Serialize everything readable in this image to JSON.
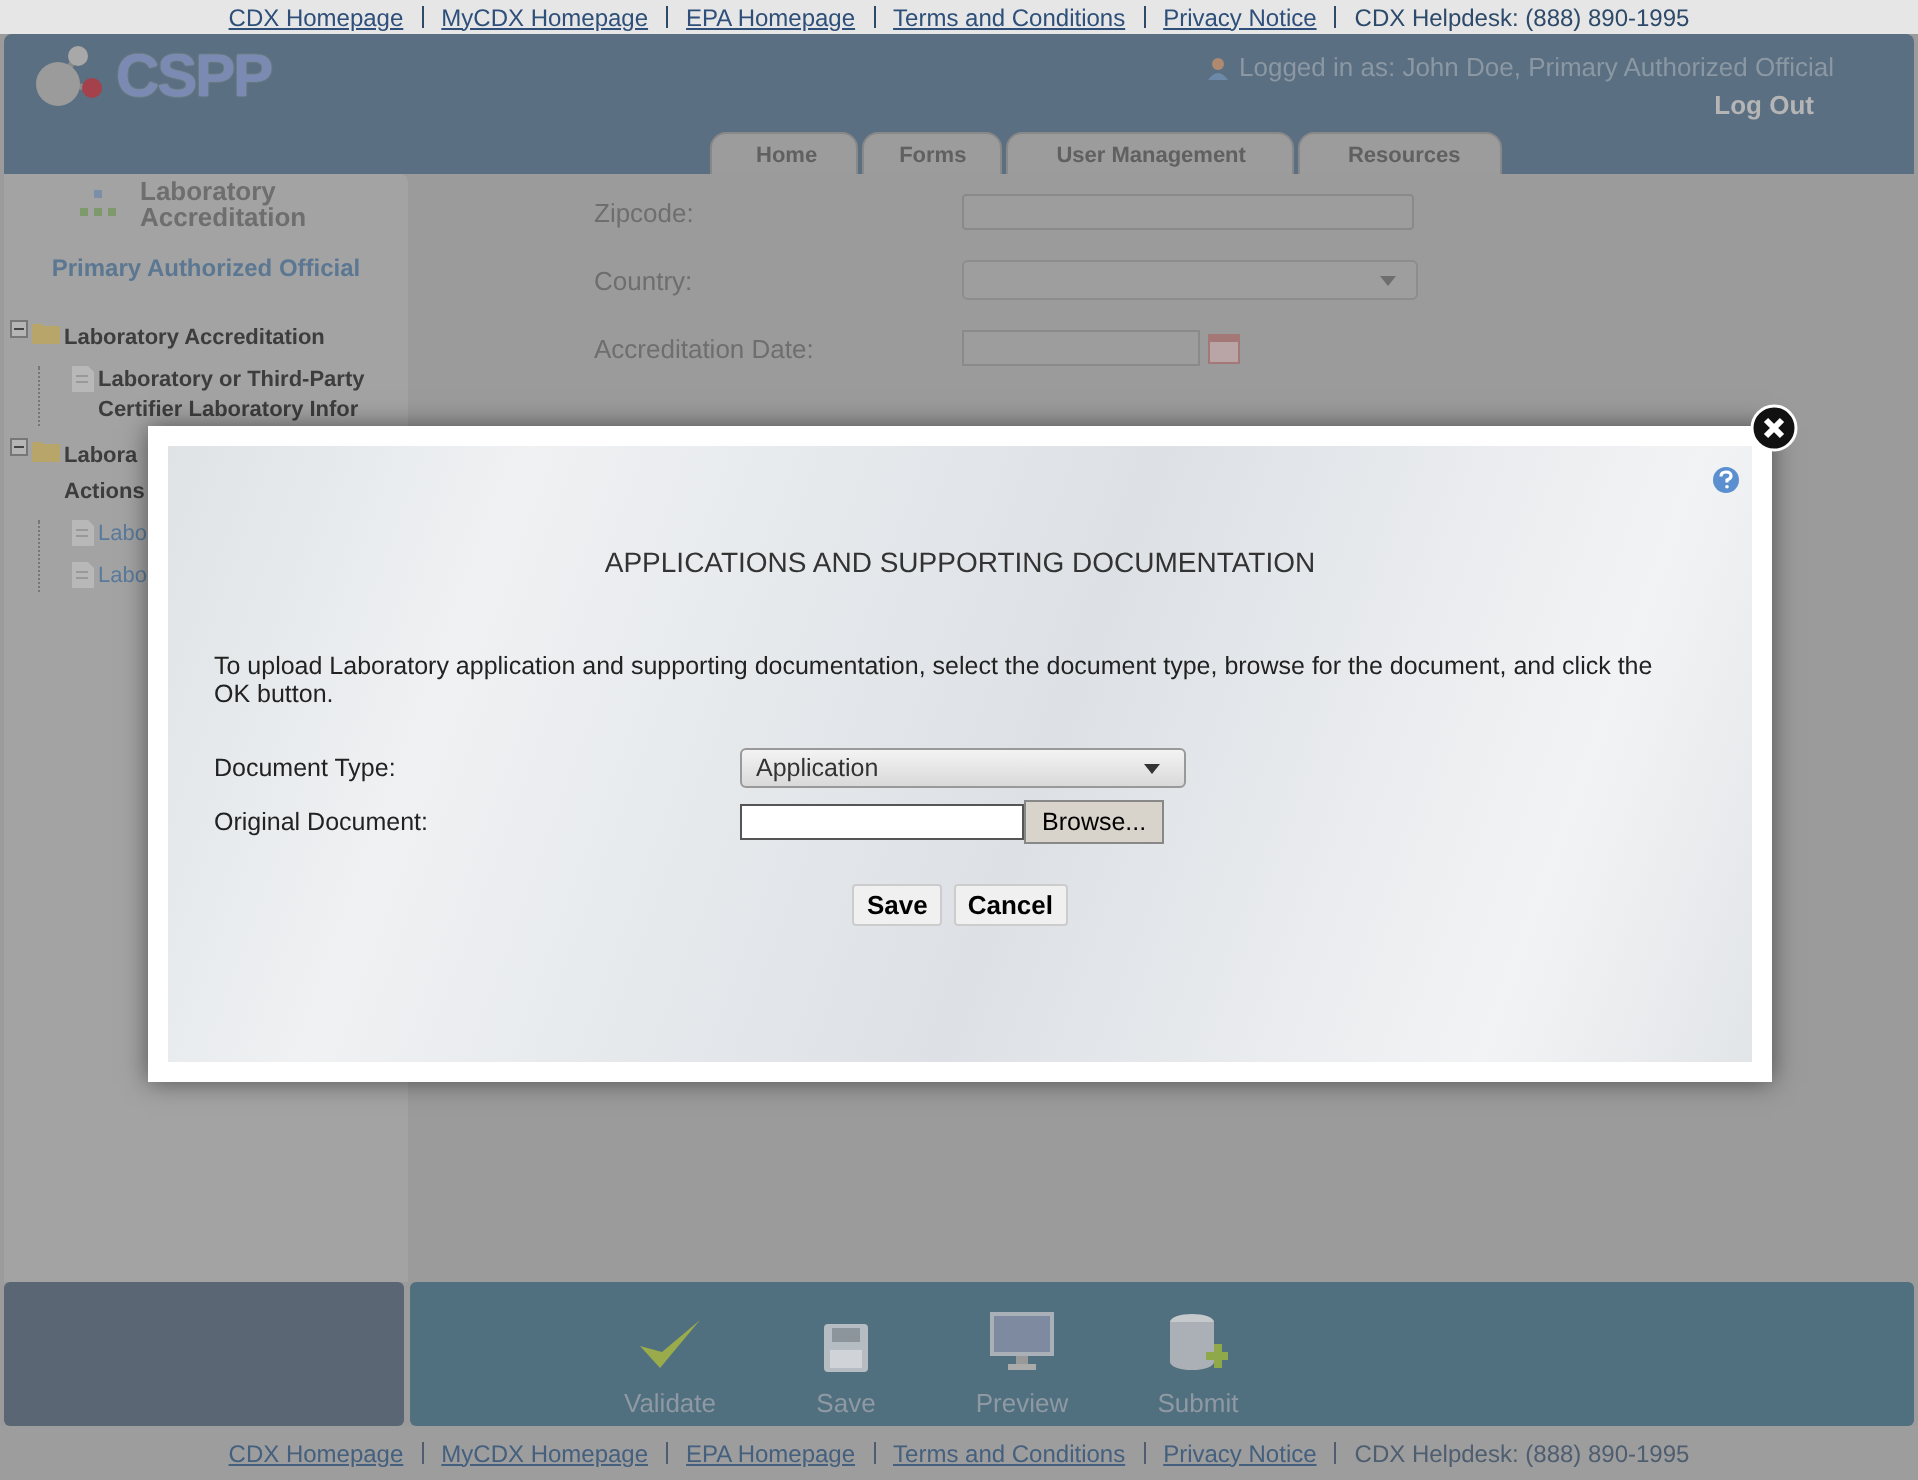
{
  "top_links": {
    "links": [
      "CDX Homepage",
      "MyCDX Homepage",
      "EPA Homepage",
      "Terms and Conditions",
      "Privacy Notice"
    ],
    "helpdesk": "CDX Helpdesk: (888) 890-1995"
  },
  "header": {
    "logo": "CSPP",
    "logged_in_label": "Logged in as:",
    "user": "John Doe, Primary Authorized Official",
    "logout": "Log Out",
    "tabs": [
      "Home",
      "Forms",
      "User Management",
      "Resources"
    ]
  },
  "sidebar": {
    "title": "Laboratory Accreditation",
    "role": "Primary Authorized Official",
    "tree": [
      {
        "label": "Laboratory Accreditation",
        "kind": "folder",
        "expanded": true,
        "children": [
          {
            "label": "Laboratory or Third-Party Certifier Laboratory Infor",
            "kind": "page",
            "selected": true
          }
        ]
      },
      {
        "label": "Labora Actions",
        "kind": "folder",
        "expanded": true,
        "children": [
          {
            "label": "Labo",
            "kind": "page",
            "selected": false
          },
          {
            "label": "Labo",
            "kind": "page",
            "selected": false
          }
        ]
      }
    ]
  },
  "form": {
    "fields": [
      {
        "label": "Zipcode:",
        "kind": "text"
      },
      {
        "label": "Country:",
        "kind": "select"
      },
      {
        "label": "Accreditation Date:",
        "kind": "date"
      }
    ]
  },
  "dialog": {
    "title": "APPLICATIONS AND SUPPORTING DOCUMENTATION",
    "instructions": "To upload Laboratory application and supporting documentation, select the document type, browse for the document, and click the OK button.",
    "document_type_label": "Document Type:",
    "document_type_value": "Application",
    "original_document_label": "Original Document:",
    "browse": "Browse...",
    "buttons": [
      "Save",
      "Cancel"
    ]
  },
  "toolbar": [
    {
      "label": "Validate",
      "kind": "validate"
    },
    {
      "label": "Save",
      "kind": "save"
    },
    {
      "label": "Preview",
      "kind": "preview"
    },
    {
      "label": "Submit",
      "kind": "submit"
    }
  ],
  "footer_links": {
    "links": [
      "CDX Homepage",
      "MyCDX Homepage",
      "EPA Homepage",
      "Terms and Conditions",
      "Privacy Notice"
    ],
    "helpdesk": "CDX Helpdesk: (888) 890-1995"
  }
}
